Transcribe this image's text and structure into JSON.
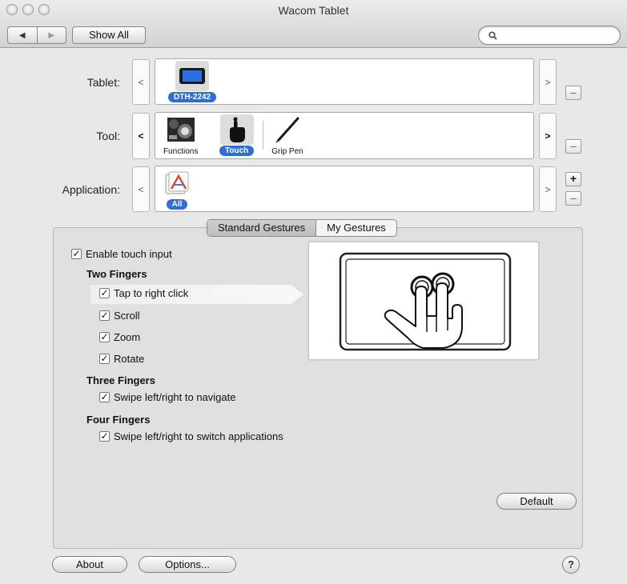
{
  "window": {
    "title": "Wacom Tablet"
  },
  "toolbar": {
    "back_icon": "◀",
    "forward_icon": "▶",
    "show_all_label": "Show All",
    "search_value": "",
    "search_icon": "search-icon"
  },
  "tablet_row": {
    "label": "Tablet:",
    "prev": "<",
    "next": ">",
    "remove": "–",
    "items": [
      {
        "name": "DTH-2242",
        "selected": true,
        "icon": "tablet-display-icon"
      }
    ]
  },
  "tool_row": {
    "label": "Tool:",
    "prev": "<",
    "next": ">",
    "remove": "–",
    "items": [
      {
        "name": "Functions",
        "selected": false,
        "icon": "functions-icon"
      },
      {
        "name": "Touch",
        "selected": true,
        "icon": "touch-hand-icon"
      },
      {
        "name": "Grip Pen",
        "selected": false,
        "icon": "grip-pen-icon"
      }
    ]
  },
  "application_row": {
    "label": "Application:",
    "prev": "<",
    "next": ">",
    "add": "+",
    "remove": "–",
    "items": [
      {
        "name": "All",
        "selected": true,
        "icon": "all-applications-icon"
      }
    ]
  },
  "tabs": [
    {
      "label": "Standard Gestures",
      "active": true
    },
    {
      "label": "My Gestures",
      "active": false
    }
  ],
  "gestures": {
    "enable_touch": {
      "label": "Enable touch input",
      "checked": true
    },
    "two_fingers": {
      "heading": "Two Fingers",
      "options": [
        {
          "label": "Tap to right click",
          "checked": true
        },
        {
          "label": "Scroll",
          "checked": true
        },
        {
          "label": "Zoom",
          "checked": true
        },
        {
          "label": "Rotate",
          "checked": true
        }
      ]
    },
    "three_fingers": {
      "heading": "Three Fingers",
      "options": [
        {
          "label": "Swipe left/right to navigate",
          "checked": true
        }
      ]
    },
    "four_fingers": {
      "heading": "Four Fingers",
      "options": [
        {
          "label": "Swipe left/right to switch applications",
          "checked": true
        }
      ]
    },
    "preview_icon": "two-finger-tap-icon"
  },
  "buttons": {
    "default_label": "Default",
    "about_label": "About",
    "options_label": "Options...",
    "help_label": "?"
  },
  "colors": {
    "selection_pill": "#2f6fd1",
    "window_bg": "#e8e8e8",
    "panel_bg": "#e0e0e0"
  }
}
